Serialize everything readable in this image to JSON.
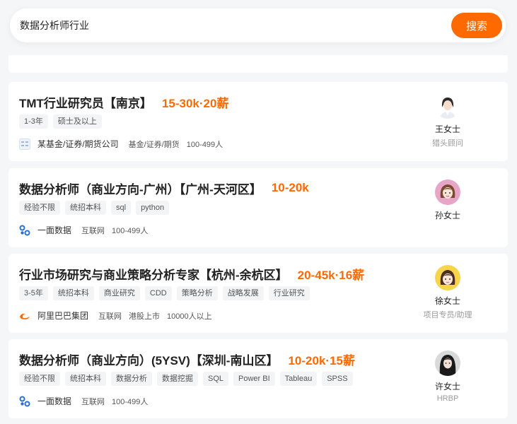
{
  "search": {
    "query": "数据分析师行业",
    "button_label": "搜索"
  },
  "jobs": [
    {
      "title": "TMT行业研究员【南京】",
      "salary": "15-30k·20薪",
      "tags": [
        "1-3年",
        "硕士及以上"
      ],
      "company": {
        "logo_icon": "fund-company-logo",
        "name": "某基金/证券/期货公司",
        "meta": [
          "基金/证券/期货",
          "100-499人"
        ]
      },
      "recruiter": {
        "name": "王女士",
        "role": "猎头顾问",
        "avatar_icon": "recruiter-avatar-wang"
      }
    },
    {
      "title": "数据分析师（商业方向-广州）【广州-天河区】",
      "salary": "10-20k",
      "tags": [
        "经验不限",
        "统招本科",
        "sql",
        "python"
      ],
      "company": {
        "logo_icon": "yimian-logo",
        "name": "一面数据",
        "meta": [
          "互联网",
          "100-499人"
        ]
      },
      "recruiter": {
        "name": "孙女士",
        "role": "",
        "avatar_icon": "recruiter-avatar-sun"
      }
    },
    {
      "title": "行业市场研究与商业策略分析专家【杭州-余杭区】",
      "salary": "20-45k·16薪",
      "tags": [
        "3-5年",
        "统招本科",
        "商业研究",
        "CDD",
        "策略分析",
        "战略发展",
        "行业研究"
      ],
      "company": {
        "logo_icon": "alibaba-logo",
        "name": "阿里巴巴集团",
        "meta": [
          "互联网",
          "港股上市",
          "10000人以上"
        ]
      },
      "recruiter": {
        "name": "徐女士",
        "role": "项目专员/助理",
        "avatar_icon": "recruiter-avatar-xu"
      }
    },
    {
      "title": "数据分析师（商业方向）(5YSV)【深圳-南山区】",
      "salary": "10-20k·15薪",
      "tags": [
        "经验不限",
        "统招本科",
        "数据分析",
        "数据挖掘",
        "SQL",
        "Power BI",
        "Tableau",
        "SPSS"
      ],
      "company": {
        "logo_icon": "yimian-logo",
        "name": "一面数据",
        "meta": [
          "互联网",
          "100-499人"
        ]
      },
      "recruiter": {
        "name": "许女士",
        "role": "HRBP",
        "avatar_icon": "recruiter-avatar-xu-2"
      }
    }
  ],
  "colors": {
    "accent": "#ff6a00",
    "background": "#f5f6f8",
    "card": "#ffffff"
  }
}
